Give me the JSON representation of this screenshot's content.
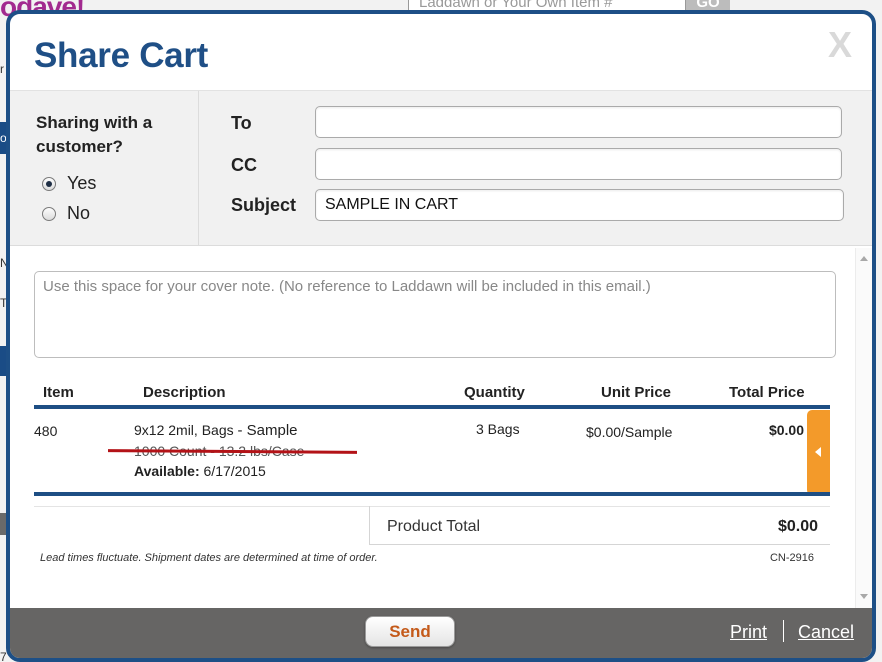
{
  "background": {
    "logo_text": "odave!",
    "search_placeholder": "Laddawn or Your Own Item #",
    "go_label": "GO",
    "edge_letters": [
      "r",
      "o",
      "N",
      "T",
      "7"
    ]
  },
  "modal": {
    "title": "Share Cart",
    "close_label": "X"
  },
  "share_with_customer": {
    "question": "Sharing with a customer?",
    "options": [
      {
        "label": "Yes",
        "checked": true
      },
      {
        "label": "No",
        "checked": false
      }
    ]
  },
  "fields": {
    "to": {
      "label": "To",
      "value": ""
    },
    "cc": {
      "label": "CC",
      "value": ""
    },
    "subject": {
      "label": "Subject",
      "value": "SAMPLE IN CART"
    }
  },
  "cover_note": {
    "placeholder": "Use this space for your cover note. (No reference to Laddawn will be included in this email.)",
    "value": ""
  },
  "table": {
    "headers": {
      "item": "Item",
      "description": "Description",
      "quantity": "Quantity",
      "unit_price": "Unit Price",
      "total_price": "Total Price"
    },
    "rows": [
      {
        "item": "480",
        "description": "9x12 2mil, Bags",
        "sample_label": "- Sample",
        "struck_detail": "1000 Count  -  13.2 lbs/Case",
        "available_label": "Available:",
        "available_date": "6/17/2015",
        "quantity": "3 Bags",
        "unit_price": "$0.00/Sample",
        "total_price": "$0.00"
      }
    ]
  },
  "totals": {
    "product_total_label": "Product Total",
    "product_total_value": "$0.00"
  },
  "notes": {
    "lead_times": "Lead times fluctuate. Shipment dates are determined at time of order.",
    "code": "CN-2916"
  },
  "footer": {
    "send_label": "Send",
    "print_label": "Print",
    "cancel_label": "Cancel"
  },
  "colors": {
    "brand_navy": "#1f4f86",
    "accent_orange": "#f39a2a",
    "strike_red": "#b31217",
    "footer_gray": "#666564"
  }
}
